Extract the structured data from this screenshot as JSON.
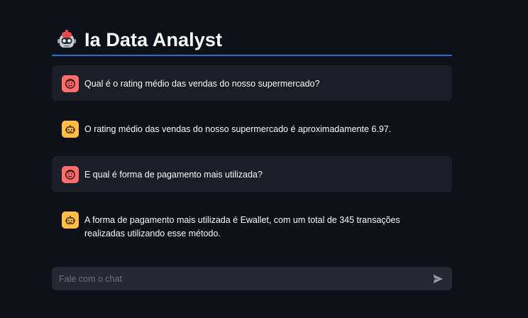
{
  "header": {
    "title": "Ia Data Analyst",
    "logo_icon": "robot-face-icon"
  },
  "messages": [
    {
      "role": "user",
      "icon": "user-face-icon",
      "text": "Qual é o rating médio das vendas do nosso supermercado?"
    },
    {
      "role": "assistant",
      "icon": "robot-icon",
      "text": "O rating médio das vendas do nosso supermercado é aproximadamente 6.97."
    },
    {
      "role": "user",
      "icon": "user-face-icon",
      "text": "E qual é forma de pagamento mais utilizada?"
    },
    {
      "role": "assistant",
      "icon": "robot-icon",
      "text": "A forma de pagamento mais utilizada é Ewallet, com um total de 345 transações realizadas utilizando esse método."
    }
  ],
  "chat_input": {
    "placeholder": "Fale com o chat",
    "value": "",
    "send_icon": "send-icon"
  },
  "colors": {
    "background": "#0e1117",
    "user_avatar": "#ff6c6c",
    "bot_avatar": "#ffbd45",
    "divider": "#1f6fd1"
  }
}
